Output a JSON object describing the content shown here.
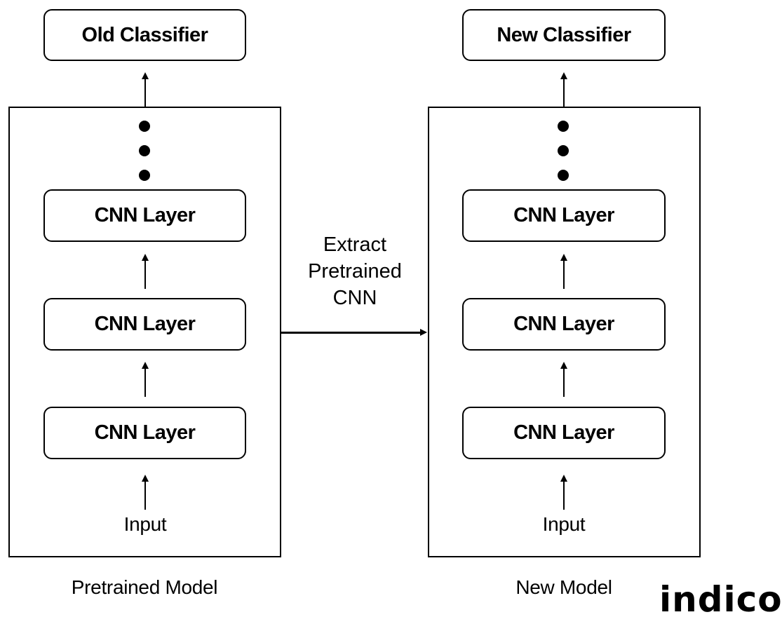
{
  "diagram": {
    "left_model": {
      "caption": "Pretrained Model",
      "classifier": "Old Classifier",
      "layers": [
        "CNN Layer",
        "CNN Layer",
        "CNN Layer"
      ],
      "input_label": "Input"
    },
    "right_model": {
      "caption": "New Model",
      "classifier": "New Classifier",
      "layers": [
        "CNN Layer",
        "CNN Layer",
        "CNN Layer"
      ],
      "input_label": "Input"
    },
    "transfer_label": [
      "Extract",
      "Pretrained",
      "CNN"
    ],
    "logo": "indico"
  }
}
